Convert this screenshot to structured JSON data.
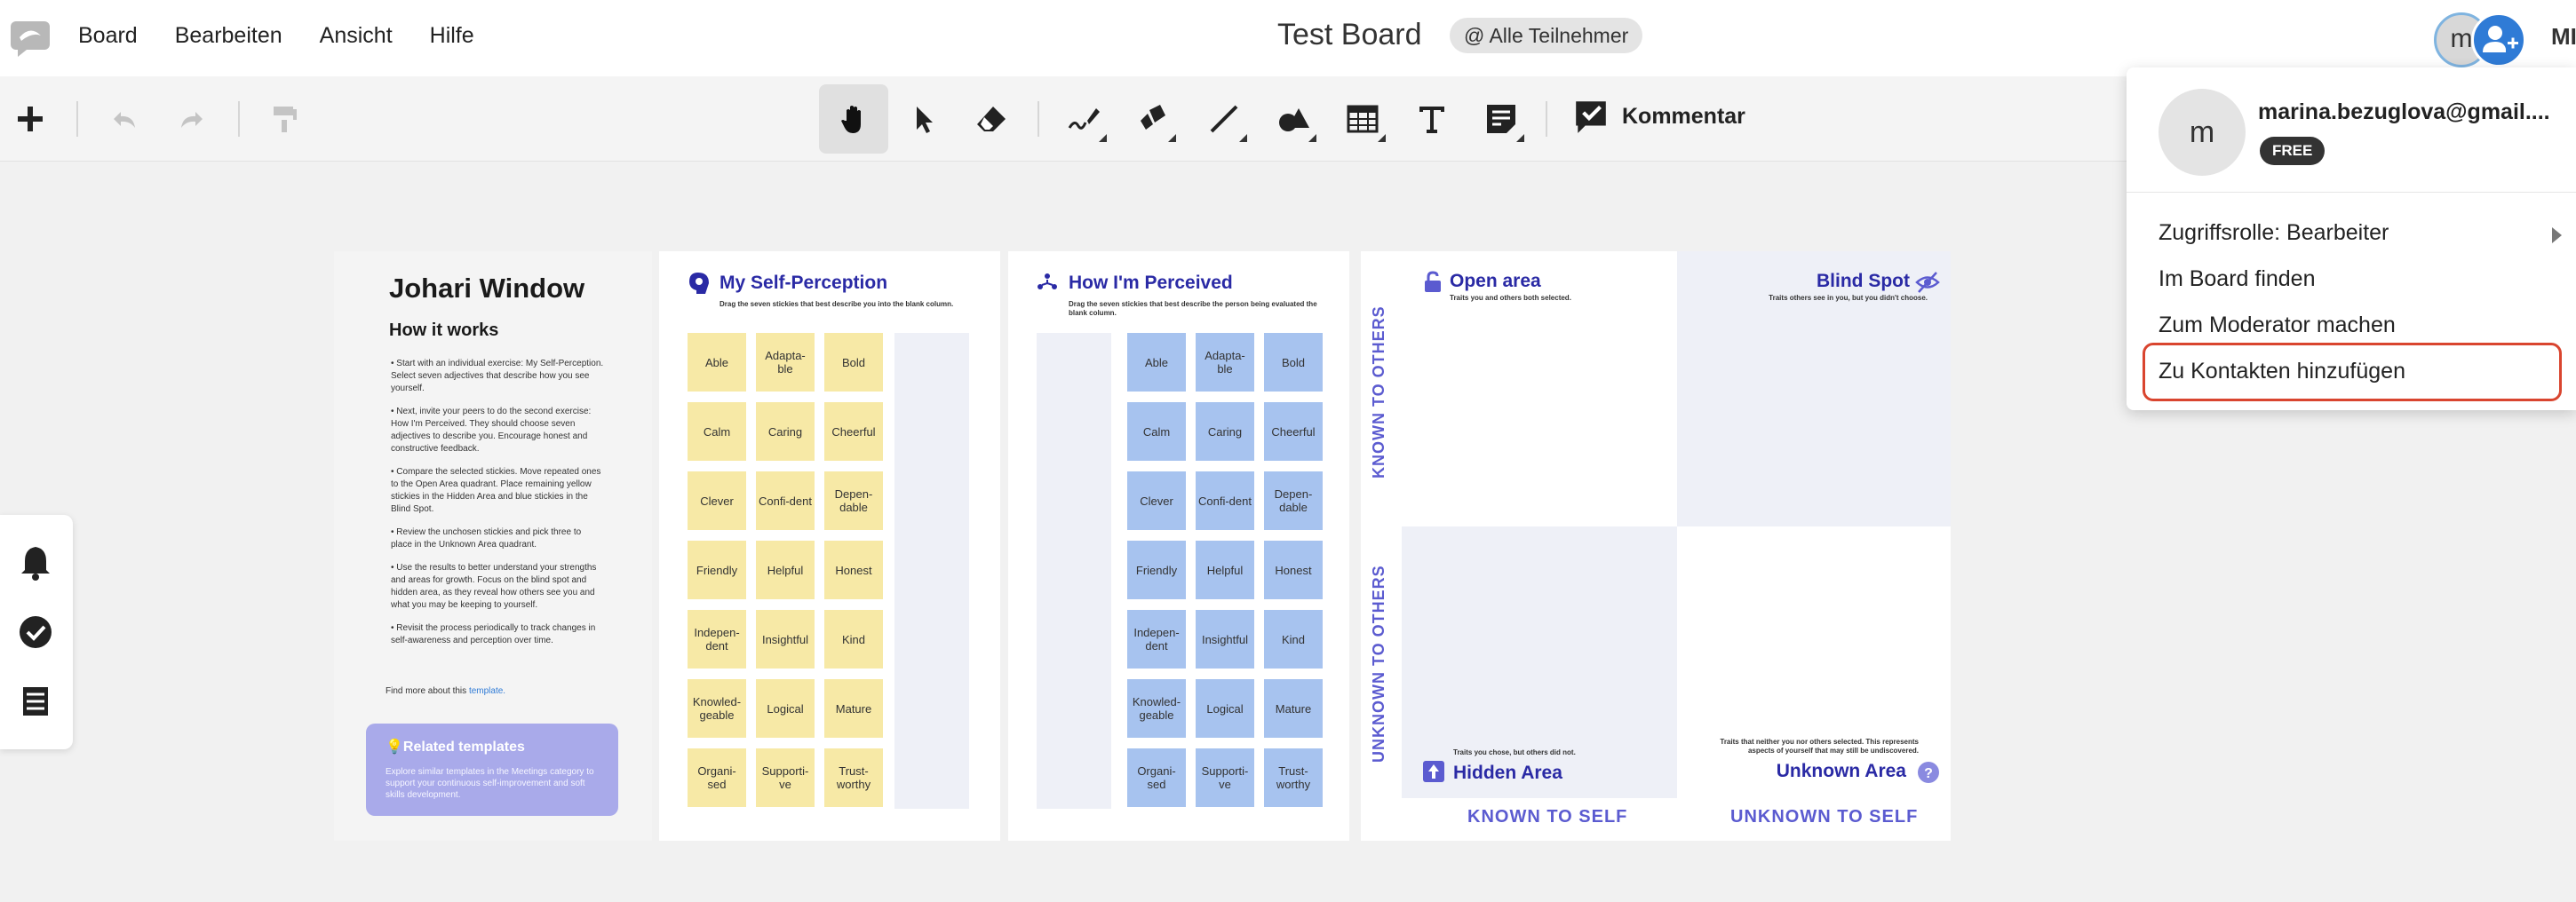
{
  "menu": [
    "Board",
    "Bearbeiten",
    "Ansicht",
    "Hilfe"
  ],
  "board_title": "Test Board",
  "participants_chip": "@ Alle Teilnehmer",
  "avatar_initial": "m",
  "header_initials": "MI",
  "toolbar": {
    "comment_label": "Kommentar",
    "tools": [
      "add-icon",
      "undo-icon",
      "redo-icon",
      "format-painter-icon",
      "hand-icon",
      "pointer-icon",
      "eraser-icon",
      "pen-icon",
      "marker-icon",
      "line-icon",
      "shapes-icon",
      "table-icon",
      "text-icon",
      "sticky-note-icon",
      "comment-icon"
    ]
  },
  "side_panel": [
    "bell-icon",
    "check-circle-icon",
    "list-icon"
  ],
  "intro": {
    "title": "Johari Window",
    "subtitle": "How it works",
    "steps": [
      "Start with an individual exercise: My Self-Perception. Select seven adjectives that describe how you see yourself.",
      "Next, invite your peers to do the second exercise: How I'm Perceived. They should choose seven adjectives to describe you. Encourage honest and constructive feedback.",
      "Compare the selected stickies. Move repeated ones to the Open Area quadrant. Place remaining yellow stickies in the Hidden Area and blue stickies in the Blind Spot.",
      "Review the unchosen stickies and pick three to place in the Unknown Area quadrant.",
      "Use the results to better understand your strengths and areas for growth. Focus on the blind spot and hidden area, as they reveal how others see you and what you may be keeping to yourself.",
      "Revisit the process periodically to track changes in self-awareness and perception over time."
    ],
    "find_more": "Find more about this",
    "find_more_link": "template.",
    "related_title": "Related templates",
    "related_desc": "Explore similar templates in the Meetings category to support your continuous self-improvement and soft skills development."
  },
  "self_perception": {
    "title": "My Self-Perception",
    "subtitle": "Drag the seven stickies that best describe you into the blank column."
  },
  "perceived": {
    "title": "How I'm Perceived",
    "subtitle": "Drag the seven stickies that best describe the person being evaluated the blank column."
  },
  "adjectives": [
    "Able",
    "Adapta-ble",
    "Bold",
    "Calm",
    "Caring",
    "Cheerful",
    "Clever",
    "Confi-dent",
    "Depen-dable",
    "Friendly",
    "Helpful",
    "Honest",
    "Indepen-dent",
    "Insightful",
    "Kind",
    "Knowled-geable",
    "Logical",
    "Mature",
    "Organi-sed",
    "Supporti-ve",
    "Trust-worthy"
  ],
  "window": {
    "open_title": "Open area",
    "open_sub": "Traits you and others both selected.",
    "blind_title": "Blind Spot",
    "blind_sub": "Traits others see in you, but you didn't choose.",
    "hidden_title": "Hidden Area",
    "hidden_sub": "Traits you chose, but others did not.",
    "unknown_title": "Unknown Area",
    "unknown_sub": "Traits that neither you nor others selected. This represents aspects of yourself that may still be undiscovered.",
    "known_to_others": "KNOWN TO OTHERS",
    "unknown_to_others": "UNKNOWN TO OTHERS",
    "known_to_self": "KNOWN TO SELF",
    "unknown_to_self": "UNKNOWN TO SELF"
  },
  "dropdown": {
    "avatar": "m",
    "email": "marina.bezuglova@gmail....",
    "badge": "FREE",
    "items": [
      "Zugriffsrolle: Bearbeiter",
      "Im Board finden",
      "Zum Moderator machen",
      "Zu Kontakten hinzufügen"
    ]
  },
  "colors": {
    "accent_title": "#2a2aa5",
    "yellow_sticky": "#f7e9a6",
    "blue_sticky": "#a7c3ef",
    "related_bg": "#a9aaea",
    "highlight": "#d9452f"
  }
}
